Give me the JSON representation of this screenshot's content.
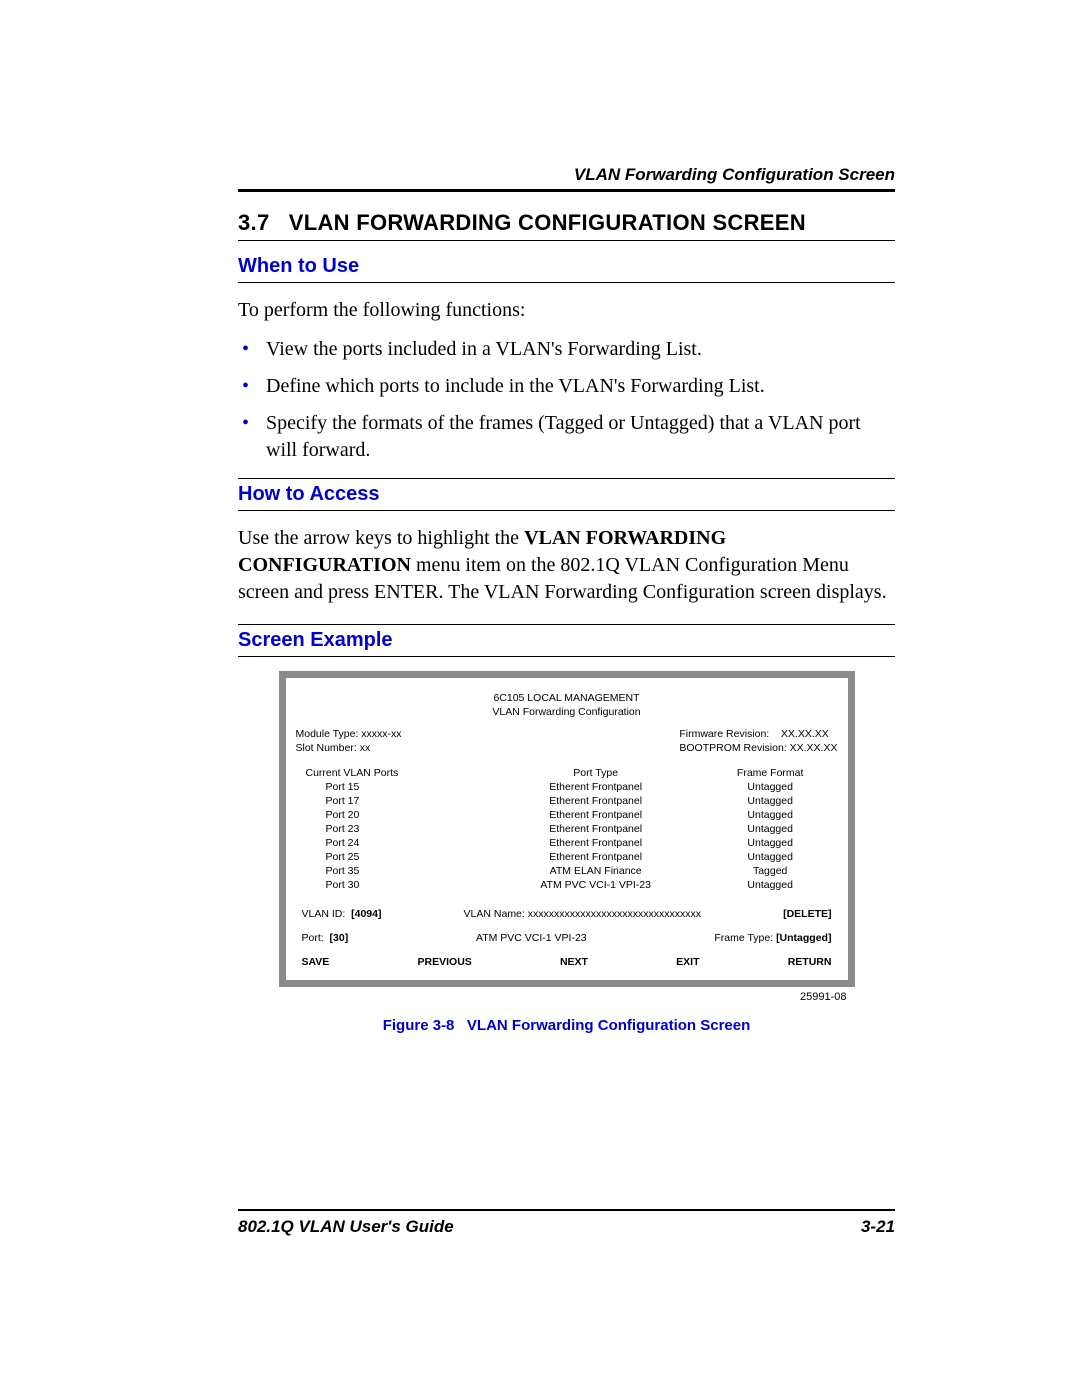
{
  "running_head": "VLAN Forwarding Configuration Screen",
  "section": {
    "number": "3.7",
    "title": "VLAN FORWARDING CONFIGURATION SCREEN"
  },
  "when_to_use": {
    "heading": "When to Use",
    "intro": "To perform the following functions:",
    "bullets": [
      "View the ports included in a VLAN's Forwarding List.",
      "Define which ports to include in the VLAN's Forwarding List.",
      "Specify the formats of the frames (Tagged or Untagged) that a VLAN port will forward."
    ]
  },
  "how_to_access": {
    "heading": "How to Access",
    "pre": "Use the arrow keys to highlight the ",
    "bold": "VLAN FORWARDING CONFIGURATION",
    "post": " menu item on the 802.1Q VLAN Configuration Menu screen and press ENTER. The VLAN Forwarding Configuration screen displays."
  },
  "screen_example": {
    "heading": "Screen Example"
  },
  "screen": {
    "title_line1": "6C105  LOCAL MANAGEMENT",
    "title_line2": "VLAN Forwarding Configuration",
    "module_type_label": "Module Type: xxxxx-xx",
    "slot_number_label": "Slot Number: xx",
    "firmware_label": "Firmware Revision:",
    "firmware_value": "XX.XX.XX",
    "bootprom_label": "BOOTPROM Revision: XX.XX.XX",
    "cols": {
      "c1": "Current VLAN Ports",
      "c2": "Port Type",
      "c3": "Frame Format"
    },
    "rows": [
      {
        "port": "Port 15",
        "type": "Etherent Frontpanel",
        "fmt": "Untagged"
      },
      {
        "port": "Port 17",
        "type": "Etherent Frontpanel",
        "fmt": "Untagged"
      },
      {
        "port": "Port 20",
        "type": "Etherent Frontpanel",
        "fmt": "Untagged"
      },
      {
        "port": "Port 23",
        "type": "Etherent Frontpanel",
        "fmt": "Untagged"
      },
      {
        "port": "Port 24",
        "type": "Etherent Frontpanel",
        "fmt": "Untagged"
      },
      {
        "port": "Port 25",
        "type": "Etherent Frontpanel",
        "fmt": "Untagged"
      },
      {
        "port": "Port 35",
        "type": "ATM  ELAN Finance",
        "fmt": "Tagged"
      },
      {
        "port": "Port 30",
        "type": "ATM PVC VCI-1  VPI-23",
        "fmt": "Untagged"
      }
    ],
    "vlan_id_label": "VLAN ID:",
    "vlan_id_value": "[4094]",
    "vlan_name_label": "VLAN Name: xxxxxxxxxxxxxxxxxxxxxxxxxxxxxxxxx",
    "delete_label": "[DELETE]",
    "port_label": "Port:",
    "port_value": "[30]",
    "pvc_label": "ATM PVC VCI-1 VPI-23",
    "frame_type_label": "Frame Type:",
    "frame_type_value": "[Untagged]",
    "actions": {
      "save": "SAVE",
      "previous": "PREVIOUS",
      "next": "NEXT",
      "exit": "EXIT",
      "return": "RETURN"
    }
  },
  "figure": {
    "id": "25991-08",
    "caption_label": "Figure 3-8",
    "caption_text": "VLAN Forwarding Configuration Screen"
  },
  "footer": {
    "left": "802.1Q VLAN User's Guide",
    "right": "3-21"
  }
}
